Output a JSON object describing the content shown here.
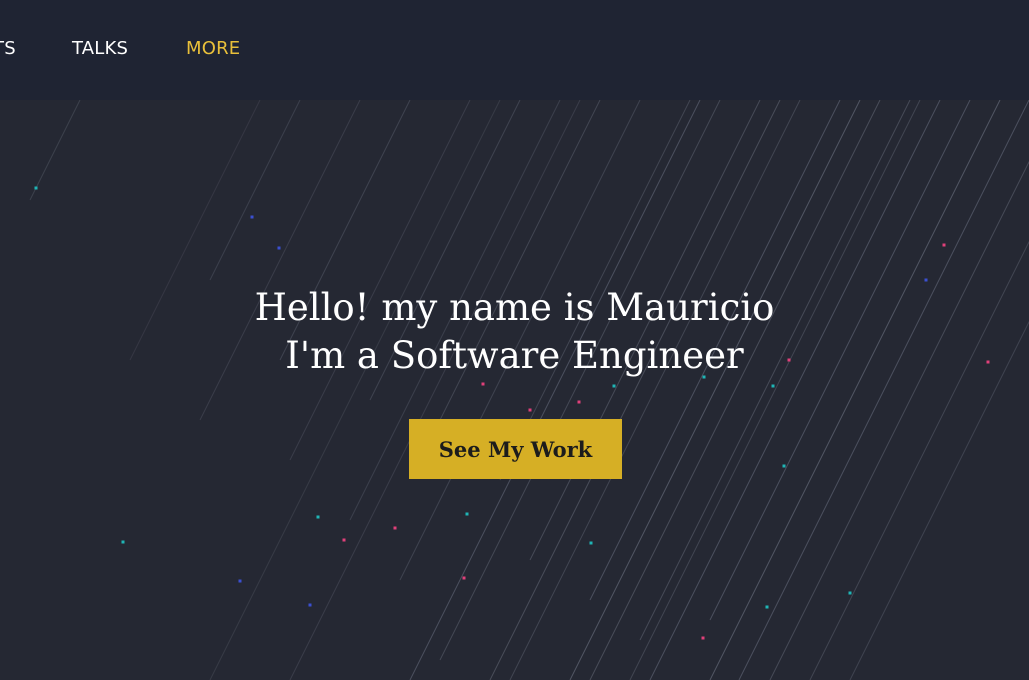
{
  "nav": {
    "items": [
      {
        "label": "TS"
      },
      {
        "label": "TALKS"
      },
      {
        "label": "MORE"
      }
    ]
  },
  "hero": {
    "line1": "Hello! my name is Mauricio",
    "line2": "I'm a Software Engineer",
    "cta_label": "See My Work"
  },
  "colors": {
    "background": "#252833",
    "nav_background": "#1f2433",
    "accent": "#e9c03a",
    "button": "#d6af25",
    "particle_cyan": "#1fb5b5",
    "particle_pink": "#e0407a",
    "particle_blue": "#3b4fd0"
  }
}
